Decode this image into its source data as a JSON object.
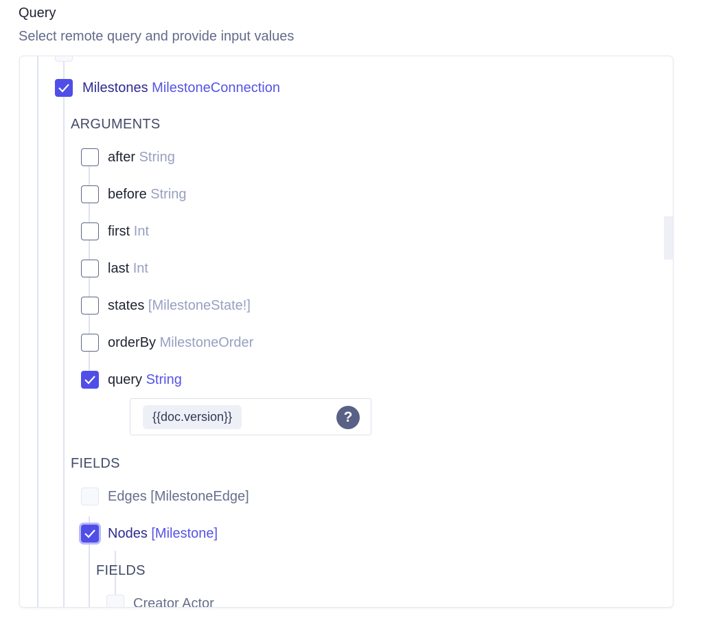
{
  "header": {
    "title": "Query",
    "subtitle": "Select remote query and provide input values"
  },
  "root": {
    "name": "Milestones",
    "type": "MilestoneConnection",
    "checked": true
  },
  "arguments_label": "ARGUMENTS",
  "arguments": [
    {
      "name": "after",
      "type": "String",
      "checked": false
    },
    {
      "name": "before",
      "type": "String",
      "checked": false
    },
    {
      "name": "first",
      "type": "Int",
      "checked": false
    },
    {
      "name": "last",
      "type": "Int",
      "checked": false
    },
    {
      "name": "states",
      "type": "[MilestoneState!]",
      "checked": false
    },
    {
      "name": "orderBy",
      "type": "MilestoneOrder",
      "checked": false
    },
    {
      "name": "query",
      "type": "String",
      "checked": true
    }
  ],
  "query_input": {
    "value": "{{doc.version}}",
    "help_icon": "question-circle-icon"
  },
  "fields_label": "FIELDS",
  "fields": [
    {
      "name": "Edges",
      "type": "[MilestoneEdge]",
      "checked": false
    },
    {
      "name": "Nodes",
      "type": "[Milestone]",
      "checked": true
    }
  ],
  "subfields_label": "FIELDS",
  "subfields": [
    {
      "name": "Creator",
      "type": "Actor",
      "checked": false
    }
  ],
  "colors": {
    "accent": "#4f4ee8",
    "help": "#596187"
  }
}
